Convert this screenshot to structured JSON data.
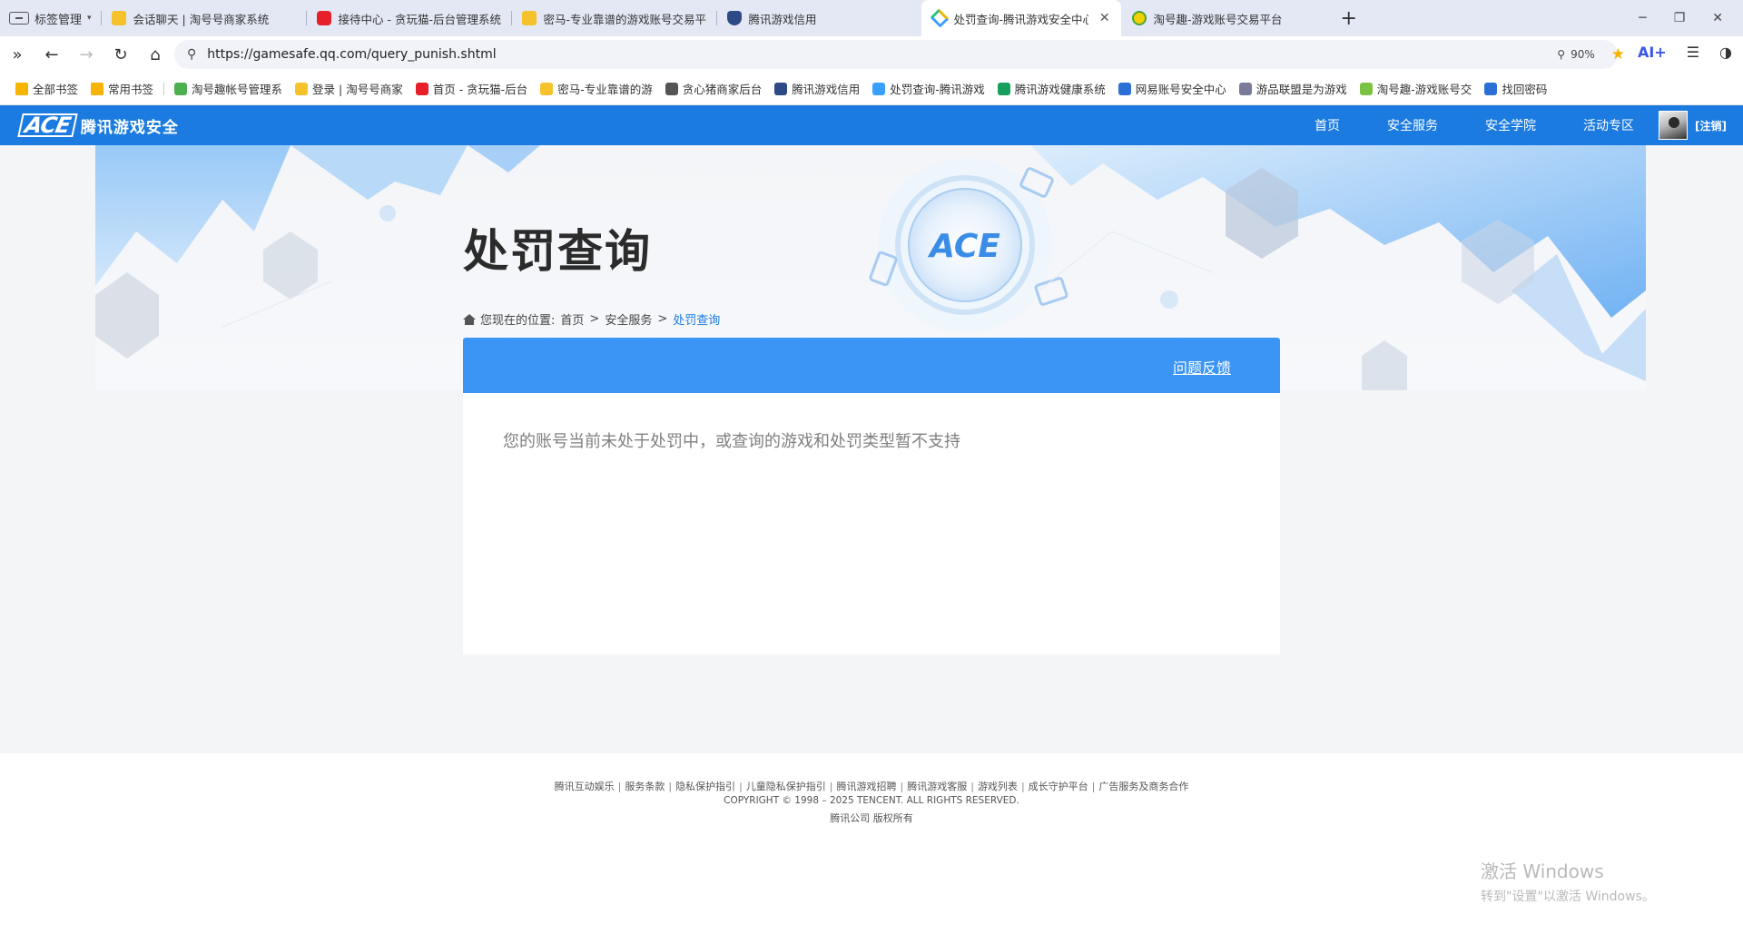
{
  "browser": {
    "tab_manager_label": "标签管理",
    "tabs": [
      {
        "title": "会话聊天 | 淘号号商家系统",
        "favicon": "yellow"
      },
      {
        "title": "接待中心 - 贪玩猫-后台管理系统",
        "favicon": "red"
      },
      {
        "title": "密马-专业靠谱的游戏账号交易平",
        "favicon": "yellow"
      },
      {
        "title": "腾讯游戏信用",
        "favicon": "shield"
      },
      {
        "title": "处罚查询-腾讯游戏安全中心官",
        "favicon": "diamond",
        "active": true
      },
      {
        "title": "淘号趣-游戏账号交易平台",
        "favicon": "smile"
      }
    ],
    "url": "https://gamesafe.qq.com/query_punish.shtml",
    "zoom": "90%",
    "ai_label": "AI+",
    "bookmarks": [
      {
        "label": "全部书签",
        "color": "#f6b300"
      },
      {
        "label": "常用书签",
        "color": "#f6b300"
      },
      {
        "label": "淘号趣帐号管理系",
        "color": "#4caf50"
      },
      {
        "label": "登录 | 淘号号商家",
        "color": "#f6c22b"
      },
      {
        "label": "首页 - 贪玩猫-后台",
        "color": "#e5202b"
      },
      {
        "label": "密马-专业靠谱的游",
        "color": "#f6c22b"
      },
      {
        "label": "贪心猪商家后台",
        "color": "#555555"
      },
      {
        "label": "腾讯游戏信用",
        "color": "#2e4a86"
      },
      {
        "label": "处罚查询-腾讯游戏",
        "color": "#3aa0ff"
      },
      {
        "label": "腾讯游戏健康系统",
        "color": "#17a05d"
      },
      {
        "label": "网易账号安全中心",
        "color": "#2b6fd6"
      },
      {
        "label": "游品联盟是为游戏",
        "color": "#7a7a9a"
      },
      {
        "label": "淘号趣-游戏账号交",
        "color": "#7cc242"
      },
      {
        "label": "找回密码",
        "color": "#2b6fd6"
      }
    ]
  },
  "site": {
    "logo_text": "腾讯游戏安全",
    "logo_mark": "ACE",
    "nav": [
      "首页",
      "安全服务",
      "安全学院",
      "活动专区"
    ],
    "user_action": "[注销]",
    "brand_color": "#1c7be0"
  },
  "page": {
    "title": "处罚查询",
    "breadcrumb": {
      "prefix": "您现在的位置:",
      "items": [
        "首页",
        "安全服务"
      ],
      "current": "处罚查询"
    },
    "feedback_label": "问题反馈",
    "message": "您的账号当前未处于处罚中，或查询的游戏和处罚类型暂不支持"
  },
  "footer": {
    "links": [
      "腾讯互动娱乐",
      "服务条款",
      "隐私保护指引",
      "儿童隐私保护指引",
      "腾讯游戏招聘",
      "腾讯游戏客服",
      "游戏列表",
      "成长守护平台",
      "广告服务及商务合作"
    ],
    "copyright": "COPYRIGHT © 1998 – 2025 TENCENT. ALL RIGHTS RESERVED.",
    "company": "腾讯公司 版权所有"
  },
  "watermark": {
    "line1": "激活 Windows",
    "line2": "转到\"设置\"以激活 Windows。"
  }
}
